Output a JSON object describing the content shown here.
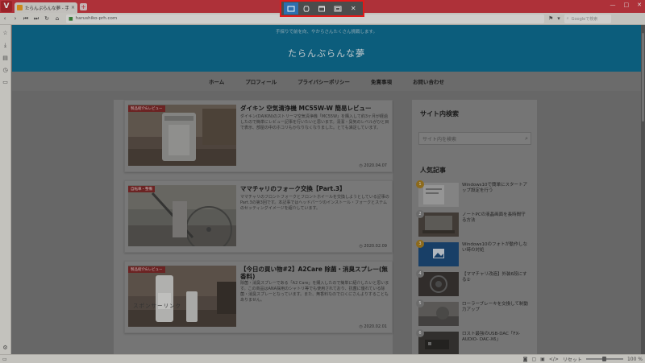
{
  "browser": {
    "logo": "V",
    "tab_title": "たらんぷらんな夢 - 手探りでも",
    "tab_close": "×",
    "new_tab": "+",
    "window_controls": [
      "—",
      "□",
      "✕"
    ],
    "url": "harushiko-prh.com",
    "search_placeholder": "Googleで検索"
  },
  "site": {
    "tagline": "手探りで前を向、やからさんたくさん挑戦します。",
    "title": "たらんぷらんな夢",
    "nav": [
      "ホーム",
      "プロフィール",
      "プライバシーポリシー",
      "免責事項",
      "お問い合わせ"
    ]
  },
  "posts": [
    {
      "category": "製品紹介&レビュー",
      "title": "ダイキン 空気清浄機 MC55W-W 簡易レビュー",
      "excerpt": "ダイキン(DAIKIN)のストリーマ空気清浄機「MC55W」を購入して約3ヶ月が経過したので簡単にレビュー記事を行いたいと思います。清潔・臭気のレベルがひと目で表示、部屋の中のホコリもかなりなくなりました。とても満足しています。",
      "date": "2020.04.07"
    },
    {
      "category": "自転車・整備",
      "title": "ママチャリのフォーク交換【Part.3】",
      "excerpt": "ママチャリのフロントフォークとフロントホイールを交換しようとしている記事のPart.3の第3回です。本記事ではヘッドパーツのインストール・フォークとステムのセッティングイメージを紹介しています。",
      "date": "2020.02.09"
    },
    {
      "category": "製品紹介&レビュー",
      "title": "【今日の買い物#2】A2Care 除菌・消臭スプレー(無香料)",
      "excerpt": "除菌・消臭スプレーである「A2 Care」を購入したので簡単に紹介したいと思います。この商品はANA採用のシャトリ等でも使用されており、抗菌に優れている除菌・消臭スプレーとなっています。また、無香料なのでロくにさんよりすることもありません。",
      "date": "2020.02.01"
    }
  ],
  "sponsor_label": "スポンサーリンク",
  "sidebar": {
    "search_heading": "サイト内検索",
    "search_placeholder": "サイト内を検索",
    "popular_heading": "人気記事",
    "popular": [
      {
        "rank": "1",
        "title": "Windows10で簡単にスタートアップ設定を行う"
      },
      {
        "rank": "2",
        "title": "ノートPCの液晶画面を長時間守る方法"
      },
      {
        "rank": "3",
        "title": "Windows10のフォトが動作しない時の対処"
      },
      {
        "rank": "4",
        "title": "【ママチャリ改造】外装6段にする②"
      },
      {
        "rank": "5",
        "title": "ローラーブレーキを交換して制動力アップ"
      },
      {
        "rank": "6",
        "title": "ロスト最強のUSB-DAC「FX-AUDIO- DAC-X6」"
      }
    ]
  },
  "status": {
    "zoom": "100 %",
    "reset": "リセット"
  },
  "capture_toolbar": {
    "buttons": [
      "capture-area-icon",
      "capture-freeform-icon",
      "capture-window-icon",
      "capture-fullscreen-icon",
      "close-icon"
    ],
    "close_glyph": "✕",
    "highlight_color": "#e21a1a",
    "active_color": "#2d6fae"
  }
}
